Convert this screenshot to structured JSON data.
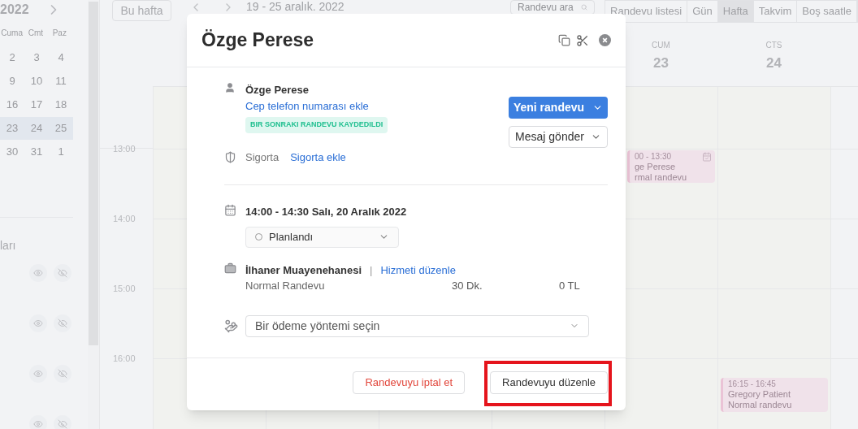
{
  "mini_calendar": {
    "title": "2022",
    "weekdays": [
      "Cuma",
      "Cmt",
      "Paz"
    ],
    "weeks": [
      {
        "days": [
          "2",
          "3",
          "4"
        ],
        "selected": false
      },
      {
        "days": [
          "9",
          "10",
          "11"
        ],
        "selected": false
      },
      {
        "days": [
          "16",
          "17",
          "18"
        ],
        "selected": false
      },
      {
        "days": [
          "23",
          "24",
          "25"
        ],
        "selected": true
      },
      {
        "days": [
          "30",
          "31",
          "1"
        ],
        "selected": false
      }
    ]
  },
  "sidebar_section": {
    "title": "ları"
  },
  "toolbar": {
    "today_button": "Bu hafta",
    "date_range": "19 - 25 aralık. 2022",
    "search": {
      "placeholder": "Randevu ara"
    },
    "views": [
      {
        "label": "Randevu listesi",
        "selected": false
      },
      {
        "label": "Gün",
        "selected": false
      },
      {
        "label": "Hafta",
        "selected": true
      },
      {
        "label": "Takvim",
        "selected": false
      },
      {
        "label": "Boş saatle",
        "selected": false
      }
    ]
  },
  "calendar": {
    "days": [
      {
        "weekday": "CUM",
        "date": "23"
      },
      {
        "weekday": "CTS",
        "date": "24"
      }
    ],
    "hours": [
      "13:00",
      "14:00",
      "15:00",
      "16:00"
    ],
    "events": [
      {
        "time": "00 - 13:30",
        "patient": "ge Perese",
        "service": "rmal randevu",
        "confirmed": true
      },
      {
        "time": "16:15 - 16:45",
        "patient": "Gregory Patient",
        "service": "Normal randevu",
        "confirmed": false
      }
    ]
  },
  "modal": {
    "title": "Özge Perese",
    "patient": {
      "name": "Özge Perese",
      "add_phone_link": "Cep telefon numarası ekle",
      "badge": "BIR SONRAKI RANDEVU KAYDEDILDI"
    },
    "insurance": {
      "label": "Sigorta",
      "link": "Sigorta ekle"
    },
    "actions": {
      "primary": "Yeni randevu",
      "secondary": "Mesaj gönder"
    },
    "appointment": {
      "datetime": "14:00 - 14:30 Salı, 20 Aralık 2022",
      "status": "Planlandı"
    },
    "service": {
      "location": "İlhaner Muayenehanesi",
      "separator": "|",
      "edit_link": "Hizmeti düzenle",
      "name": "Normal Randevu",
      "duration": "30 Dk.",
      "price": "0 TL"
    },
    "payment": {
      "placeholder": "Bir ödeme yöntemi seçin"
    },
    "footer": {
      "buttons": [
        {
          "label": "Randevuyu iptal et",
          "kind": "danger",
          "highlighted": false
        },
        {
          "label": "Randevuyu düzenle",
          "kind": "default",
          "highlighted": true
        }
      ]
    }
  }
}
